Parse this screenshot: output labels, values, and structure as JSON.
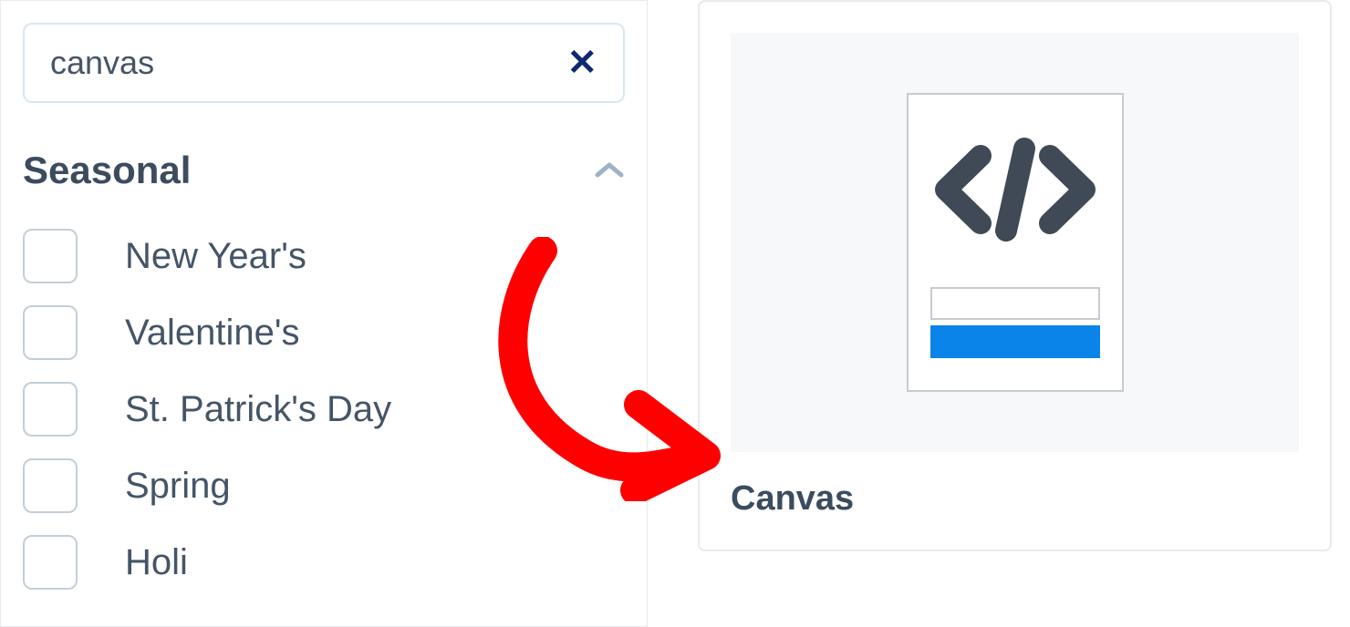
{
  "search": {
    "value": "canvas",
    "clear_glyph": "✕"
  },
  "section": {
    "title": "Seasonal",
    "chevron_glyph": "⌃",
    "items": [
      {
        "label": "New Year's"
      },
      {
        "label": "Valentine's"
      },
      {
        "label": "St. Patrick's Day"
      },
      {
        "label": "Spring"
      },
      {
        "label": "Holi"
      }
    ]
  },
  "result": {
    "title": "Canvas"
  },
  "colors": {
    "accent_blue": "#0a84e8",
    "icon_dark": "#3f4a56",
    "arrow_red": "#ff0000"
  }
}
